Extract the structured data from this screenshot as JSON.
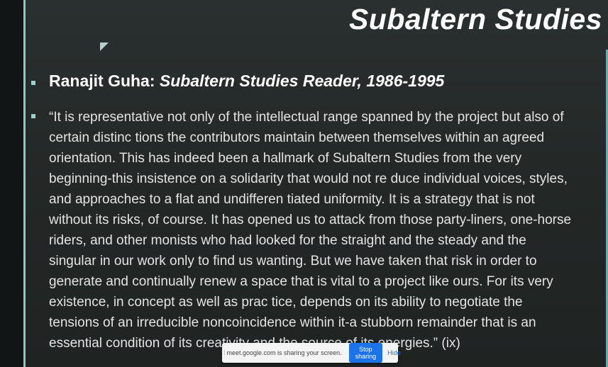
{
  "slide": {
    "title": "Subaltern Studies",
    "heading_author": "Ranajit Guha: ",
    "heading_work": "Subaltern Studies Reader, 1986-1995",
    "quote_lines": [
      "“It is representative not only of the intellectual range spanned by the project but also of",
      "certain distinc tions the contributors maintain between themselves within an agreed",
      "orientation. This has indeed been a hallmark of Subaltern Studies from the very",
      "beginning-this insistence on a solidarity that would not re duce individual voices, styles,",
      "and approaches to a flat and undifferen tiated uniformity. It is a strategy that is not",
      "without its risks, of course. It has opened us to attack from those party-liners, one-horse",
      "riders, and other monists who had looked for the straight and the steady and the",
      "singular in our work only to find us wanting. But we have taken that risk in order to",
      "generate and continually renew a space that is vital to a project like ours. For its very",
      "existence, in concept as well as prac tice, depends on its ability to negotiate the",
      "tensions of an irreducible noncoincidence within it-a stubborn remainder that is an",
      "essential condition of its creativity and the source of its energies.” (ix)"
    ]
  },
  "share_bar": {
    "message": "meet.google.com is sharing your screen.",
    "stop_label": "Stop sharing",
    "hide_label": "Hide"
  },
  "colors": {
    "accent_line": "#8fc7c3",
    "bullet": "#9dd0cc",
    "stop_button": "#1a73e8"
  }
}
